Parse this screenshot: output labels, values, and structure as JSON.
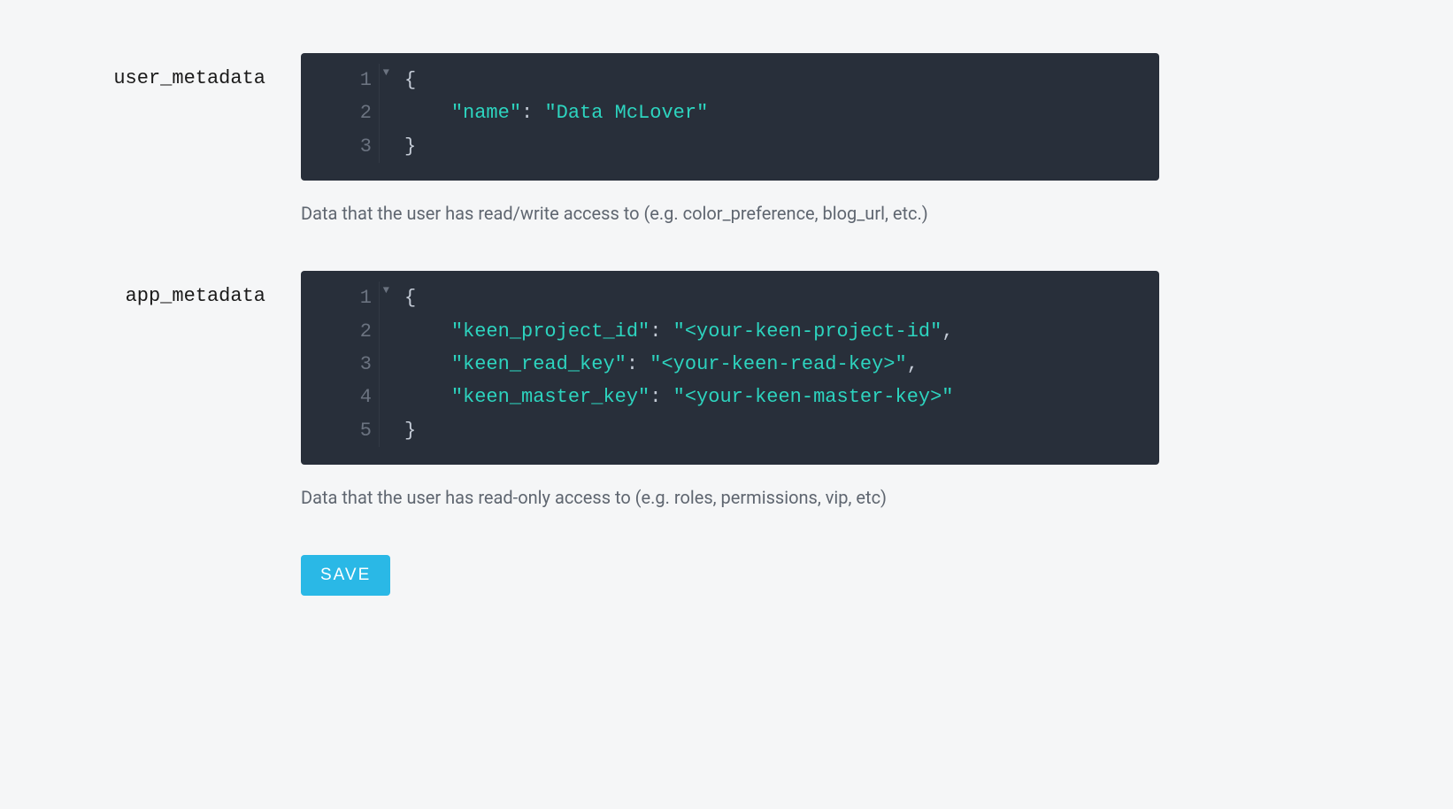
{
  "fields": {
    "user_metadata": {
      "label": "user_metadata",
      "helper": "Data that the user has read/write access to (e.g. color_preference, blog_url, etc.)",
      "code": {
        "line_numbers": [
          "1",
          "2",
          "3"
        ],
        "fold_marker": "▼",
        "lines": [
          {
            "type": "brace",
            "text": "{"
          },
          {
            "type": "kv",
            "indent": "    ",
            "key": "\"name\"",
            "colon": ": ",
            "value": "\"Data McLover\"",
            "trailing": ""
          },
          {
            "type": "brace",
            "text": "}"
          }
        ]
      }
    },
    "app_metadata": {
      "label": "app_metadata",
      "helper": "Data that the user has read-only access to (e.g. roles, permissions, vip, etc)",
      "code": {
        "line_numbers": [
          "1",
          "2",
          "3",
          "4",
          "5"
        ],
        "fold_marker": "▼",
        "lines": [
          {
            "type": "brace",
            "text": "{"
          },
          {
            "type": "kv",
            "indent": "    ",
            "key": "\"keen_project_id\"",
            "colon": ": ",
            "value": "\"<your-keen-project-id\"",
            "trailing": ","
          },
          {
            "type": "kv",
            "indent": "    ",
            "key": "\"keen_read_key\"",
            "colon": ": ",
            "value": "\"<your-keen-read-key>\"",
            "trailing": ","
          },
          {
            "type": "kv",
            "indent": "    ",
            "key": "\"keen_master_key\"",
            "colon": ": ",
            "value": "\"<your-keen-master-key>\"",
            "trailing": ""
          },
          {
            "type": "brace",
            "text": "}"
          }
        ]
      }
    }
  },
  "actions": {
    "save_label": "SAVE"
  }
}
